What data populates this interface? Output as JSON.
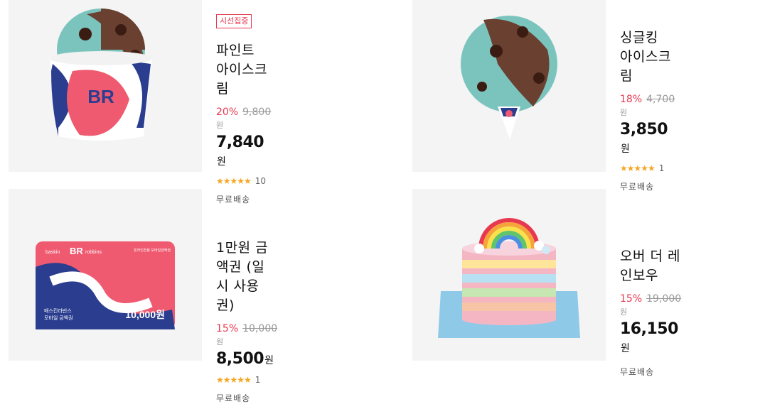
{
  "products": [
    {
      "badge": "시선집중",
      "name": "파인트 아이스크림",
      "discount": "20",
      "original_price": "9,800",
      "price": "7,840",
      "rating_count": "10",
      "shipping": "무료배송"
    },
    {
      "name": "싱글킹 아이스크림",
      "discount": "18",
      "original_price": "4,700",
      "price": "3,850",
      "rating_count": "1",
      "shipping": "무료배송"
    },
    {
      "name": "1만원 금액권 (일시 사용권)",
      "discount": "15",
      "original_price": "10,000",
      "price": "8,500",
      "rating_count": "1",
      "shipping": "무료배송",
      "card_texts": {
        "brand_left": "baskin",
        "brand_right": "robbins",
        "corner": "온라인전용 모바일금액권",
        "line1": "배스킨라빈스",
        "line2": "모바일 금액권",
        "value": "10,000원"
      }
    },
    {
      "name": "오버 더 레인보우",
      "discount": "15",
      "original_price": "19,000",
      "price": "16,150",
      "rating_count": "",
      "shipping": "무료배송"
    }
  ],
  "labels": {
    "percent": "%",
    "won": "원",
    "stars": "★★★★★",
    "logo": "BR"
  },
  "colors": {
    "discount": "#e8384f",
    "star": "#f5a623",
    "thumb_bg": "#f4f4f4"
  }
}
